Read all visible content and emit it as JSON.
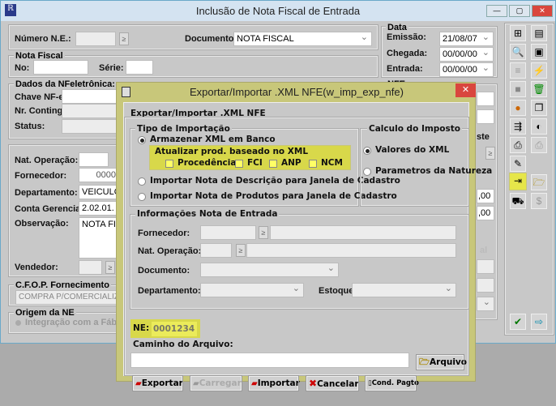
{
  "main": {
    "title": "Inclusão de Nota Fiscal de Entrada",
    "numero_label": "Número N.E.:",
    "documento_label": "Documento:",
    "documento_value": "NOTA FISCAL",
    "nota_fiscal_group": "Nota Fiscal",
    "no_label": "No:",
    "serie_label": "Série:",
    "nfe_group": "Dados da NFeletrônica:",
    "chave_label": "Chave NF-e:",
    "conting_label": "Nr. Conting.:",
    "status_label": "Status:",
    "nat_label": "Nat. Operação:",
    "fornecedor_label": "Fornecedor:",
    "fornecedor_value": "0000",
    "departamento_label": "Departamento:",
    "departamento_value": "VEICULOS",
    "conta_label": "Conta Gerencial:",
    "conta_value": "2.02.01.",
    "obs_label": "Observação:",
    "obs_value": "NOTA FISC",
    "vendedor_label": "Vendedor:",
    "cfop_group": "C.F.O.P. Fornecimento",
    "cfop_value": "COMPRA P/COMERCIALIZAC",
    "origem_group": "Origem da NE",
    "origem_option": "Integração com a Fábrica",
    "data_group": "Data",
    "emissao_label": "Emissão:",
    "emissao_value": "21/08/07",
    "chegada_label": "Chegada:",
    "chegada_value": "00/00/00",
    "entrada_label": "Entrada:",
    "entrada_value": "00/00/00",
    "nfe2_group": "NFE",
    "partial_label_1": "ste",
    "partial_label_2": "al",
    "valor1": ",00",
    "valor2": ",00"
  },
  "dialog": {
    "title": "Exportar/Importar .XML NFE(w_imp_exp_nfe)",
    "heading": "Exportar/Importar .XML NFE",
    "tipo_group": "Tipo de Importação",
    "opt_armazenar": "Armazenar XML em Banco",
    "atualizar_label": "Atualizar prod. baseado no XML",
    "checks": [
      "Procedência",
      "FCI",
      "ANP",
      "NCM"
    ],
    "opt_descricao": "Importar Nota de Descrição para Janela de Cadastro",
    "opt_produtos": "Importar Nota de Produtos para Janela de Cadastro",
    "calculo_group": "Calculo do Imposto",
    "opt_valores": "Valores do XML",
    "opt_parametros": "Parametros da Natureza",
    "info_group": "Informações Nota de Entrada",
    "fornecedor_label": "Fornecedor:",
    "nat_label": "Nat. Operação:",
    "documento_label": "Documento:",
    "departamento_label": "Departamento:",
    "estoque_label": "Estoque:",
    "ne_label": "NE:",
    "ne_value": "0001234",
    "caminho_label": "Caminho do Arquivo:",
    "caminho_value": "",
    "arquivo_btn": "Arquivo",
    "exportar_btn": "Exportar",
    "carregar_btn": "Carregar",
    "importar_btn": "Importar",
    "cancelar_btn": "Cancelar",
    "cond_btn": "Cond. Pagto"
  },
  "colors": {
    "highlight": "#ffff66",
    "dialog_border": "#c8c77a",
    "close_red": "#d9463e"
  }
}
